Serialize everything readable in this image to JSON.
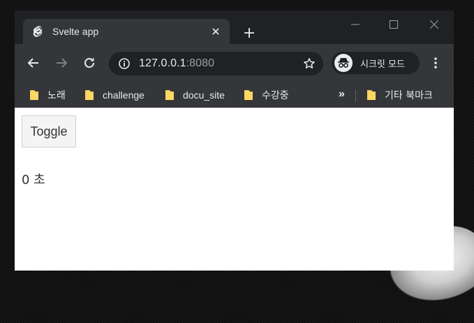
{
  "browser": {
    "tab": {
      "title": "Svelte app"
    },
    "address": {
      "host": "127.0.0.1",
      "port": ":8080"
    },
    "incognito_label": "시크릿 모드"
  },
  "bookmarks": {
    "items": [
      {
        "label": "노래"
      },
      {
        "label": "challenge"
      },
      {
        "label": "docu_site"
      },
      {
        "label": "수강중"
      }
    ],
    "more": "»",
    "other": "기타 북마크"
  },
  "page": {
    "toggle_label": "Toggle",
    "counter_text": "0 초"
  },
  "colors": {
    "titlebar": "#202124",
    "toolbar": "#35363a",
    "folder": "#fdd663",
    "svelte": "#e8eaed"
  }
}
